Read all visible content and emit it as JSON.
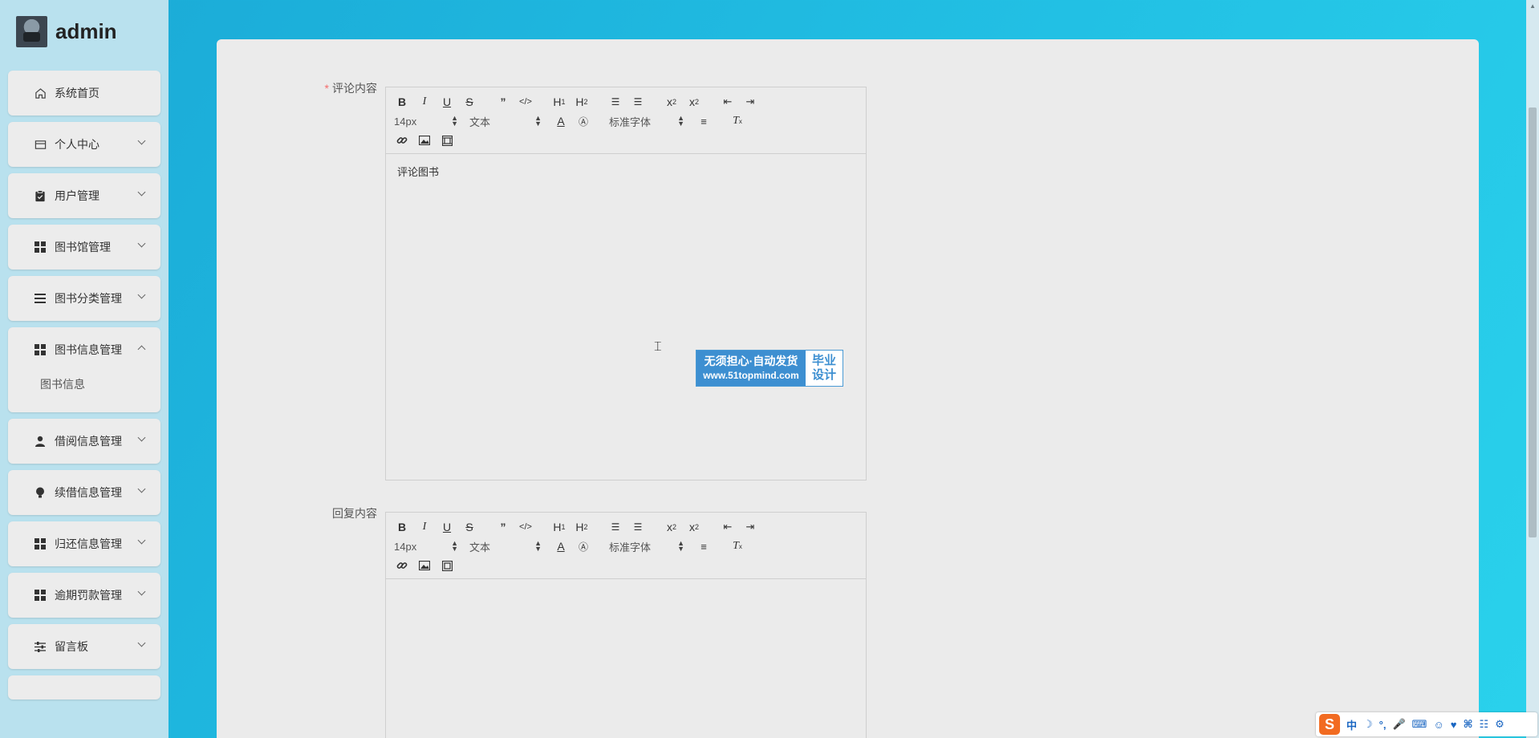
{
  "user": {
    "name": "admin"
  },
  "sidebar": {
    "items": [
      {
        "label": "系统首页",
        "icon": "home-icon",
        "expandable": false
      },
      {
        "label": "个人中心",
        "icon": "card-icon",
        "expandable": true
      },
      {
        "label": "用户管理",
        "icon": "clipboard-icon",
        "expandable": true
      },
      {
        "label": "图书馆管理",
        "icon": "grid-icon",
        "expandable": true
      },
      {
        "label": "图书分类管理",
        "icon": "list-icon",
        "expandable": true
      },
      {
        "label": "图书信息管理",
        "icon": "grid-icon",
        "expandable": true,
        "open": true,
        "children": [
          "图书信息"
        ]
      },
      {
        "label": "借阅信息管理",
        "icon": "person-icon",
        "expandable": true
      },
      {
        "label": "续借信息管理",
        "icon": "bulb-icon",
        "expandable": true
      },
      {
        "label": "归还信息管理",
        "icon": "grid-icon",
        "expandable": true
      },
      {
        "label": "逾期罚款管理",
        "icon": "grid-icon",
        "expandable": true
      },
      {
        "label": "留言板",
        "icon": "sliders-icon",
        "expandable": true
      }
    ]
  },
  "form": {
    "comment": {
      "label": "评论内容",
      "required": true,
      "content": "评论图书"
    },
    "reply": {
      "label": "回复内容",
      "required": false,
      "content": ""
    }
  },
  "editor_toolbar": {
    "font_size": "14px",
    "block_type": "文本",
    "font_family": "标准字体"
  },
  "watermark": {
    "line1": "无须担心·自动发货",
    "line2": "www.51topmind.com",
    "badge_line1": "毕业",
    "badge_line2": "设计"
  },
  "tray": {
    "logo": "S",
    "ime_mode": "中"
  }
}
